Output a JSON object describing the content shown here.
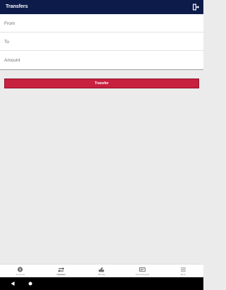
{
  "app_bar": {
    "title": "Transfers",
    "background": "#0d1b4a",
    "action_icon": "logout-icon"
  },
  "form": {
    "from_placeholder": "From",
    "to_placeholder": "To",
    "amount_placeholder": "Amount"
  },
  "transfer_button": {
    "label": "Transfer",
    "color": "#c8203f"
  },
  "bottom_nav": {
    "items": [
      {
        "label": "Accounts",
        "icon": "dollar-coin-icon",
        "active": false
      },
      {
        "label": "Transfers",
        "icon": "swap-arrows-icon",
        "active": true
      },
      {
        "label": "Bill Pay",
        "icon": "bill-pay-icon",
        "active": false
      },
      {
        "label": "Check Deposit",
        "icon": "check-deposit-icon",
        "active": false
      },
      {
        "label": "More",
        "icon": "menu-icon",
        "active": false
      }
    ]
  },
  "system_nav": {
    "back_icon": "back-triangle-icon",
    "home_icon": "home-circle-icon"
  }
}
